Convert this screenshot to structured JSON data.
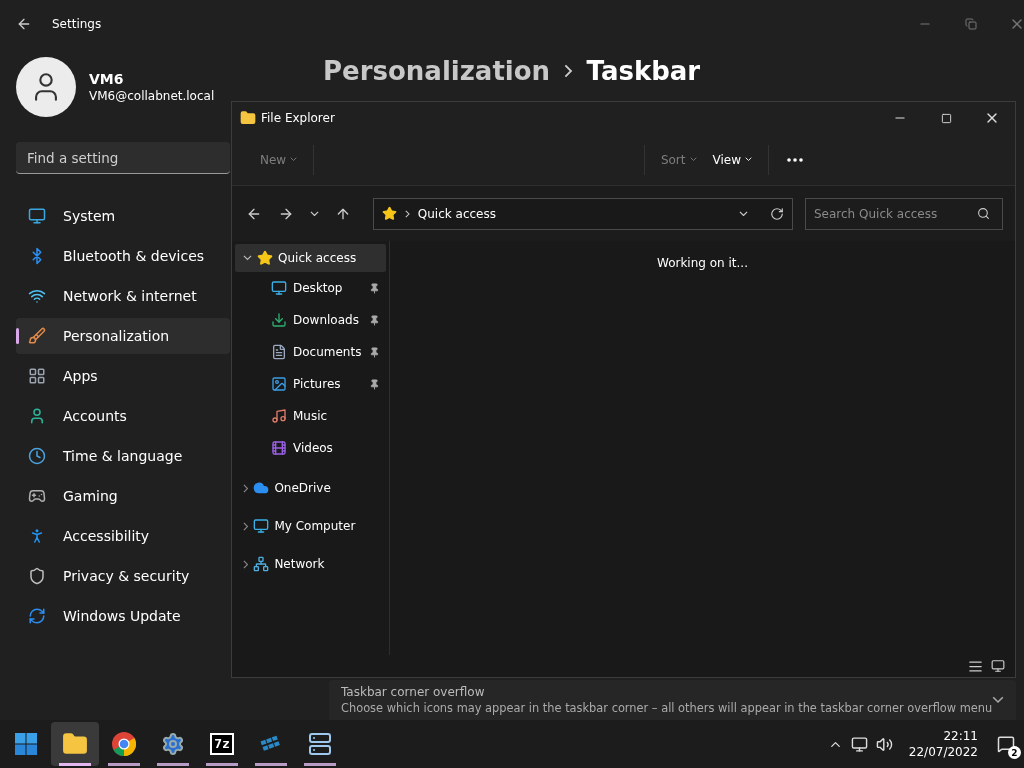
{
  "settings": {
    "title": "Settings",
    "user": {
      "name": "VM6",
      "email": "VM6@collabnet.local"
    },
    "search": {
      "placeholder": "Find a setting"
    },
    "nav": [
      {
        "label": "System",
        "selected": false
      },
      {
        "label": "Bluetooth & devices",
        "selected": false
      },
      {
        "label": "Network & internet",
        "selected": false
      },
      {
        "label": "Personalization",
        "selected": true
      },
      {
        "label": "Apps",
        "selected": false
      },
      {
        "label": "Accounts",
        "selected": false
      },
      {
        "label": "Time & language",
        "selected": false
      },
      {
        "label": "Gaming",
        "selected": false
      },
      {
        "label": "Accessibility",
        "selected": false
      },
      {
        "label": "Privacy & security",
        "selected": false
      },
      {
        "label": "Windows Update",
        "selected": false
      }
    ],
    "breadcrumb": [
      "Personalization",
      "Taskbar"
    ],
    "section": {
      "title": "Taskbar corner overflow",
      "description": "Choose which icons may appear in the taskbar corner – all others will appear in the taskbar corner overflow menu",
      "expanded": false
    }
  },
  "explorer": {
    "title": "File Explorer",
    "toolbar": [
      {
        "label": "New",
        "disabled": true
      },
      {
        "label": "Sort",
        "disabled": true
      },
      {
        "label": "View",
        "disabled": false
      }
    ],
    "address": "Quick access",
    "search": {
      "placeholder": "Search Quick access"
    },
    "tree": [
      {
        "label": "Quick access",
        "selected": true,
        "expanded": true,
        "children": [
          {
            "label": "Desktop",
            "pinned": true
          },
          {
            "label": "Downloads",
            "pinned": true
          },
          {
            "label": "Documents",
            "pinned": true
          },
          {
            "label": "Pictures",
            "pinned": true
          },
          {
            "label": "Music",
            "pinned": false
          },
          {
            "label": "Videos",
            "pinned": false
          }
        ]
      },
      {
        "label": "OneDrive",
        "selected": false,
        "expanded": false
      },
      {
        "label": "My Computer",
        "selected": false,
        "expanded": false
      },
      {
        "label": "Network",
        "selected": false,
        "expanded": false
      }
    ],
    "status": "Working on it..."
  },
  "taskbar": {
    "apps": [
      {
        "selected": false,
        "running": false
      },
      {
        "selected": true,
        "running": true
      },
      {
        "selected": false,
        "running": true
      },
      {
        "selected": false,
        "running": true
      },
      {
        "selected": false,
        "running": true,
        "label": "7z"
      },
      {
        "selected": false,
        "running": true
      },
      {
        "selected": false,
        "running": true
      }
    ],
    "clock": {
      "time": "22:11",
      "date": "22/07/2022"
    },
    "notifications": "2"
  }
}
